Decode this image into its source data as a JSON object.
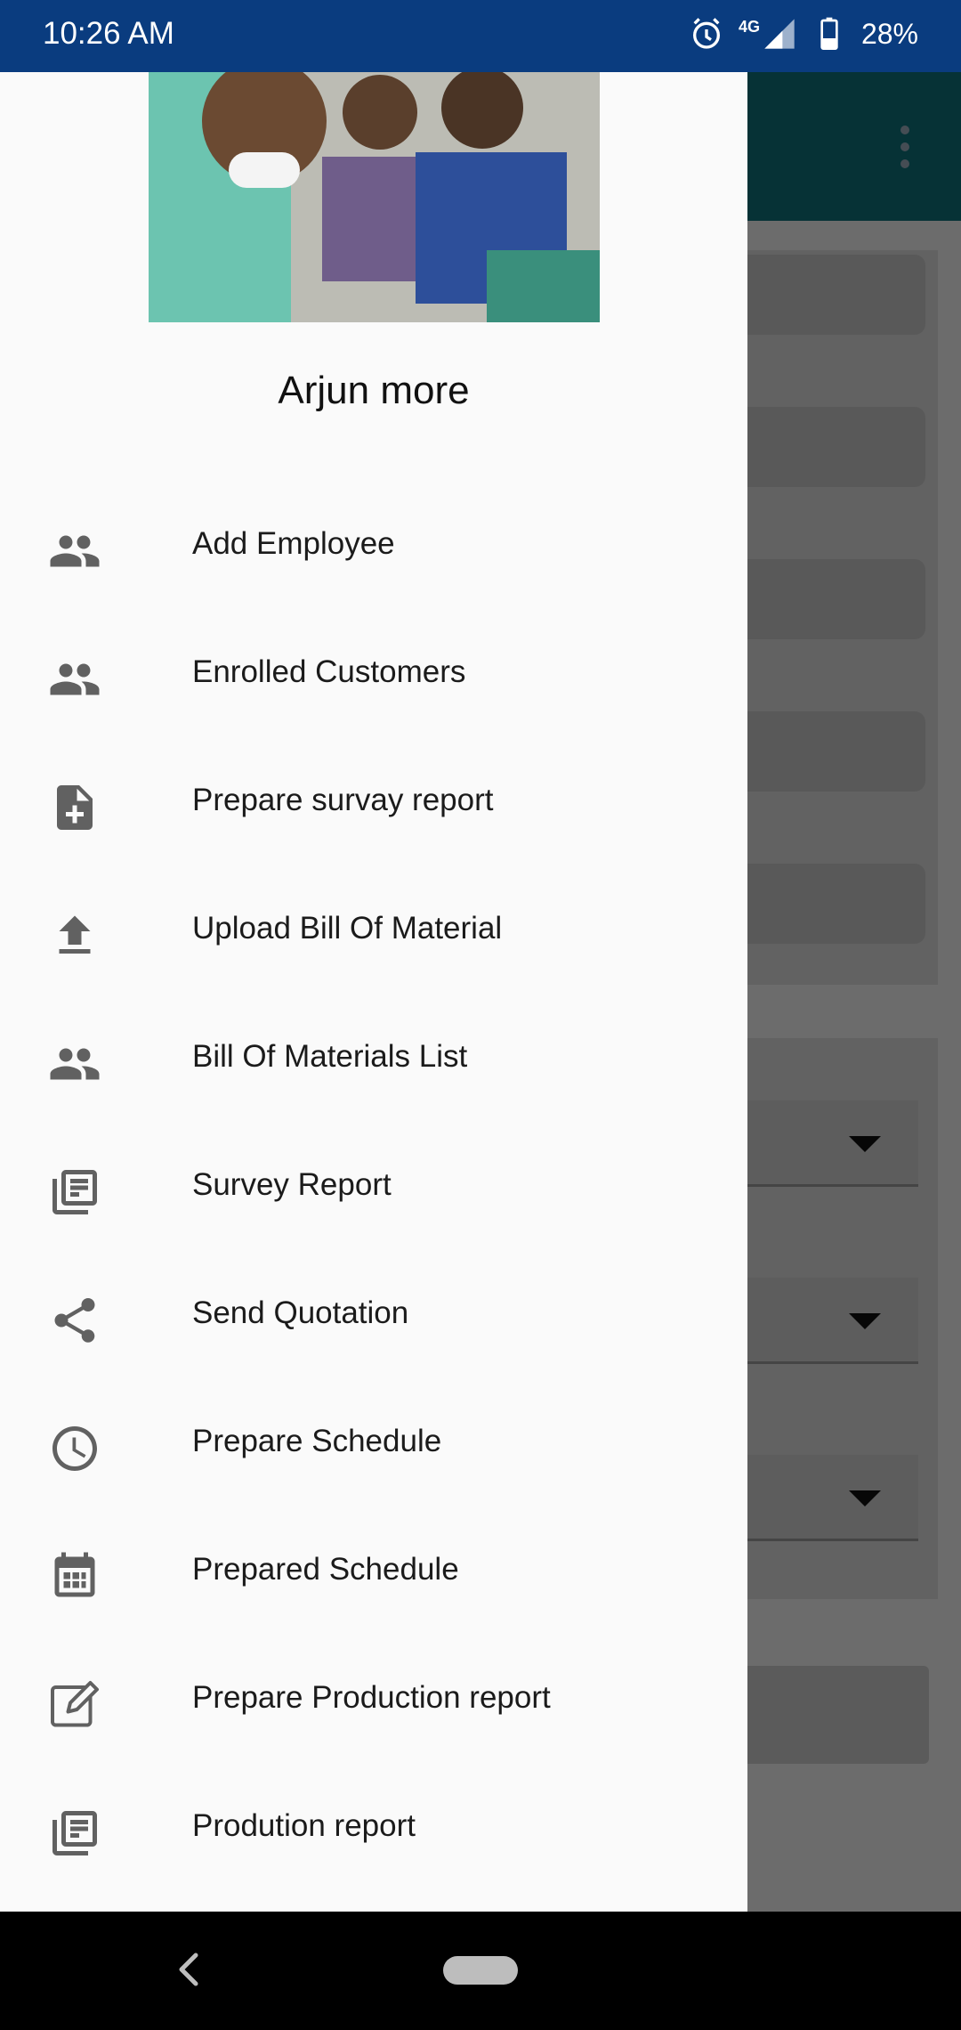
{
  "status_bar": {
    "time": "10:26 AM",
    "network": "4G",
    "battery": "28%",
    "icons": [
      "alarm-icon",
      "signal-icon",
      "battery-icon"
    ]
  },
  "drawer": {
    "user_name": "Arjun more",
    "items": [
      {
        "label": "Add Employee",
        "icon": "group-icon"
      },
      {
        "label": "Enrolled Customers",
        "icon": "group-icon"
      },
      {
        "label": "Prepare survay report",
        "icon": "note-add-icon"
      },
      {
        "label": "Upload Bill Of Material",
        "icon": "upload-icon"
      },
      {
        "label": "Bill Of Materials List",
        "icon": "group-icon"
      },
      {
        "label": "Survey Report",
        "icon": "library-books-icon"
      },
      {
        "label": "Send Quotation",
        "icon": "share-icon"
      },
      {
        "label": "Prepare Schedule",
        "icon": "clock-icon"
      },
      {
        "label": "Prepared Schedule",
        "icon": "calendar-icon"
      },
      {
        "label": "Prepare Production report",
        "icon": "edit-icon"
      },
      {
        "label": "Prodution report",
        "icon": "library-books-icon"
      }
    ]
  },
  "colors": {
    "status_bar": "#0a3c7f",
    "app_toolbar": "#0f6f78",
    "drawer_bg": "#fafafa",
    "icon": "#616161"
  }
}
